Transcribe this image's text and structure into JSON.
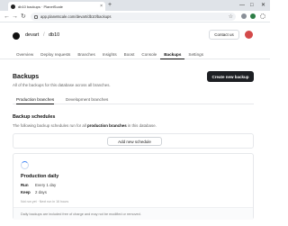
{
  "browser": {
    "tab_title": "db10 backups · PlanetScale",
    "tab_close": "×",
    "new_tab": "+",
    "url": "app.planetscale.com/devart/db10/backups",
    "window_minimize": "—",
    "window_maximize": "□",
    "window_close": "✕",
    "back": "←",
    "forward": "→",
    "reload": "↻",
    "bookmark": "☆"
  },
  "header": {
    "org": "devart",
    "separator": "/",
    "database": "db10",
    "contact_label": "Contact us",
    "nav": [
      "Overview",
      "Deploy requests",
      "Branches",
      "Insights",
      "Boost",
      "Console",
      "Backups",
      "Settings"
    ],
    "active_nav": "Backups"
  },
  "main": {
    "title": "Backups",
    "subtitle": "All of the backups for this database across all branches.",
    "create_label": "Create new backup",
    "subtabs": [
      "Production branches",
      "Development branches"
    ],
    "schedules": {
      "title": "Backup schedules",
      "desc_prefix": "The following backup schedules run for all ",
      "desc_bold": "production branches",
      "desc_suffix": " in this database.",
      "add_label": "Add new schedule"
    },
    "card": {
      "title": "Production daily",
      "run_label": "Run",
      "run_value": "Every 1 day",
      "keep_label": "Keep",
      "keep_value": "2 days",
      "meta": "Not run yet · Next run in 16 hours",
      "footer": "Daily backups are included free of charge and may not be modified or removed."
    }
  },
  "colors": {
    "primary_button": "#1d1f23",
    "spinner": "#3b82f6",
    "avatar": "#d34a4a"
  }
}
